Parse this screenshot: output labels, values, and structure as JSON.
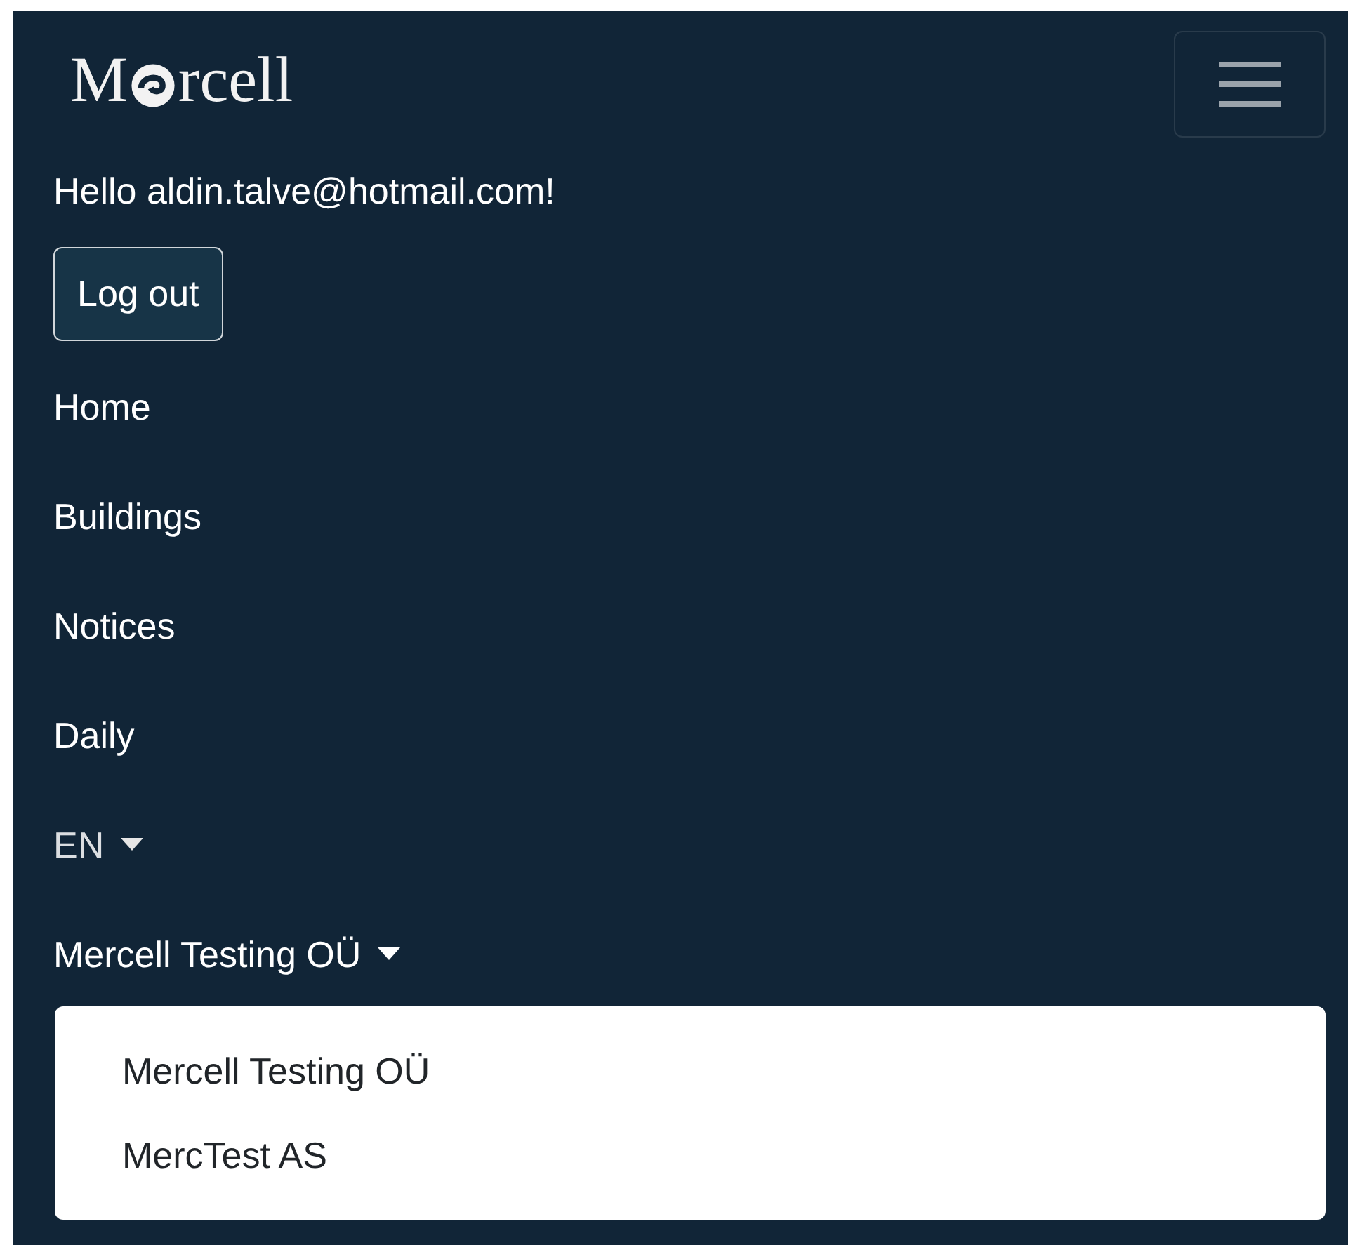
{
  "logo": {
    "start": "M",
    "end": "rcell"
  },
  "greeting": "Hello aldin.talve@hotmail.com!",
  "logout_button": "Log out",
  "nav_items": [
    {
      "label": "Home"
    },
    {
      "label": "Buildings"
    },
    {
      "label": "Notices"
    },
    {
      "label": "Daily"
    }
  ],
  "dropdowns": [
    {
      "label": "EN",
      "kind": "language",
      "expanded": false
    },
    {
      "label": "Mercell Testing OÜ",
      "kind": "company",
      "expanded": true,
      "items": [
        {
          "label": "Mercell Testing OÜ"
        },
        {
          "label": "MercTest AS"
        }
      ]
    }
  ]
}
